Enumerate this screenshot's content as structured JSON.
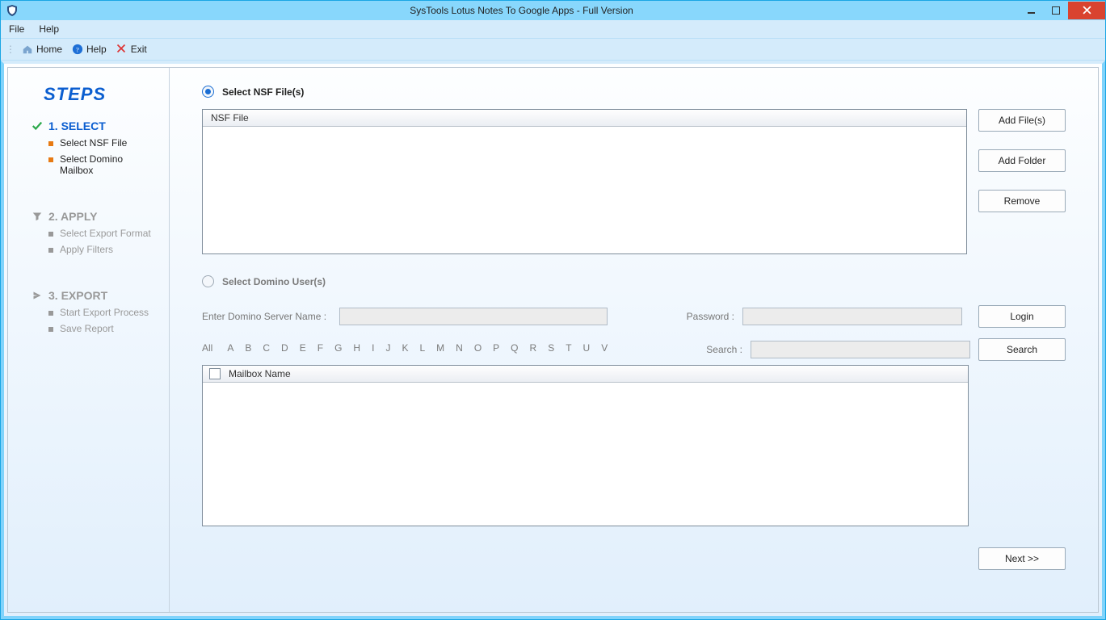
{
  "titlebar": {
    "title": "SysTools Lotus Notes To  Google Apps -  Full  Version"
  },
  "menubar": {
    "file": "File",
    "help": "Help"
  },
  "toolbar": {
    "home": "Home",
    "help": "Help",
    "exit": "Exit"
  },
  "sidebar": {
    "title": "STEPS",
    "s1": {
      "label": "1. SELECT",
      "items": [
        "Select NSF File",
        "Select Domino Mailbox"
      ]
    },
    "s2": {
      "label": "2. APPLY",
      "items": [
        "Select Export Format",
        "Apply Filters"
      ]
    },
    "s3": {
      "label": "3. EXPORT",
      "items": [
        "Start Export Process",
        "Save Report"
      ]
    }
  },
  "main": {
    "radio_nsf": "Select NSF File(s)",
    "radio_domino": "Select Domino User(s)",
    "nsf_header": "NSF File",
    "server_label": "Enter Domino Server Name :",
    "password_label": "Password :",
    "search_label": "Search :",
    "alpha_all": "All",
    "alpha": [
      "A",
      "B",
      "C",
      "D",
      "E",
      "F",
      "G",
      "H",
      "I",
      "J",
      "K",
      "L",
      "M",
      "N",
      "O",
      "P",
      "Q",
      "R",
      "S",
      "T",
      "U",
      "V"
    ],
    "mailbox_header": "Mailbox Name",
    "buttons": {
      "add_files": "Add File(s)",
      "add_folder": "Add Folder",
      "remove": "Remove",
      "login": "Login",
      "search": "Search",
      "next": "Next >>"
    }
  }
}
